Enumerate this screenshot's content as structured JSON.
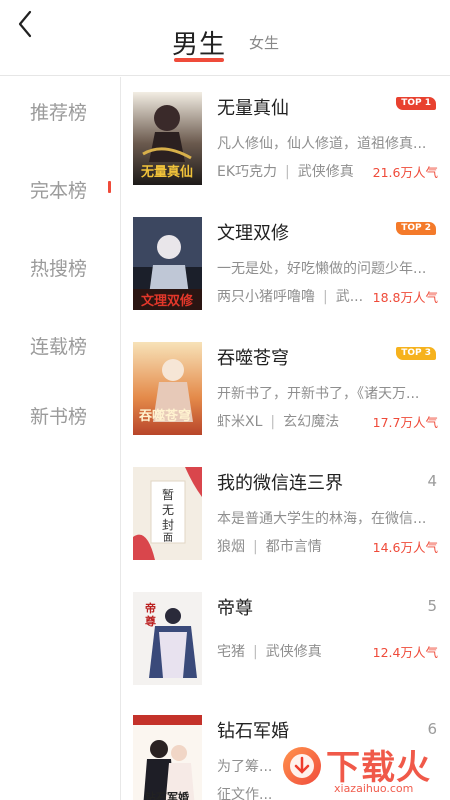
{
  "header": {
    "tabs": [
      {
        "label": "男生",
        "active": true
      },
      {
        "label": "女生",
        "active": false
      }
    ]
  },
  "sidebar": {
    "items": [
      {
        "label": "推荐榜",
        "active": false
      },
      {
        "label": "完本榜",
        "active": true
      },
      {
        "label": "热搜榜",
        "active": false
      },
      {
        "label": "连载榜",
        "active": false
      },
      {
        "label": "新书榜",
        "active": false
      }
    ]
  },
  "books": [
    {
      "title": "无量真仙",
      "desc": "凡人修仙，仙人修道，道祖修真...",
      "author": "EK巧克力",
      "category": "武侠修真",
      "popularity": "21.6万人气",
      "badge": "TOP 1",
      "badge_color": "#e8412f",
      "cover_text": "无量真仙"
    },
    {
      "title": "文理双修",
      "desc": "一无是处，好吃懒做的问题少年...",
      "author": "两只小猪呼噜噜",
      "category": "武...",
      "popularity": "18.8万人气",
      "badge": "TOP 2",
      "badge_color": "#f47a2a",
      "cover_text": "文理双修"
    },
    {
      "title": "吞噬苍穹",
      "desc": "开新书了，开新书了，《诸天万...",
      "author": "虾米XL",
      "category": "玄幻魔法",
      "popularity": "17.7万人气",
      "badge": "TOP 3",
      "badge_color": "#f6b21d",
      "cover_text": "吞噬苍穹"
    },
    {
      "title": "我的微信连三界",
      "desc": "本是普通大学生的林海，在微信...",
      "author": "狼烟",
      "category": "都市言情",
      "popularity": "14.6万人气",
      "rank": "4",
      "cover_text": "暂无封面"
    },
    {
      "title": "帝尊",
      "desc": "",
      "author": "宅猪",
      "category": "武侠修真",
      "popularity": "12.4万人气",
      "rank": "5",
      "cover_text": "帝尊"
    },
    {
      "title": "钻石军婚",
      "desc": "为了筹...",
      "author": "征文作...",
      "category": "",
      "popularity": "",
      "rank": "6",
      "cover_text": "钻石军婚"
    }
  ],
  "watermark": {
    "text": "下载火",
    "url": "xiazaihuo.com"
  },
  "colors": {
    "accent": "#ef4b3a",
    "muted": "#9b9b9b"
  }
}
